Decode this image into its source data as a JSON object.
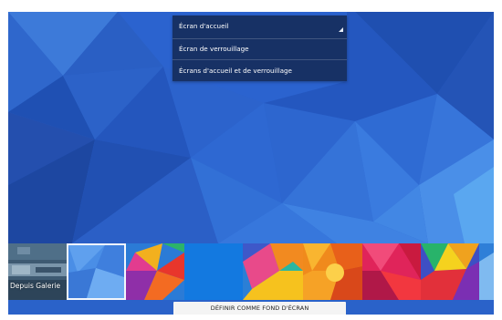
{
  "colors": {
    "wallpaper_base": "#2b63cf",
    "dropdown_bg": "#162d5c",
    "button_bg": "#f4f4f4",
    "selected_border": "#f2f6fc"
  },
  "dropdown": {
    "selected": "Écran d'accueil",
    "options": [
      "Écran de verrouillage",
      "Écrans d'accueil et de verrouillage"
    ],
    "chevron_icon": "dropdown-corner-arrow-icon"
  },
  "thumbnails": {
    "gallery_label": "Depuis Galerie",
    "selected_index": 1,
    "count": 9
  },
  "action_button": {
    "label": "DÉFINIR COMME FOND D'ÉCRAN"
  }
}
